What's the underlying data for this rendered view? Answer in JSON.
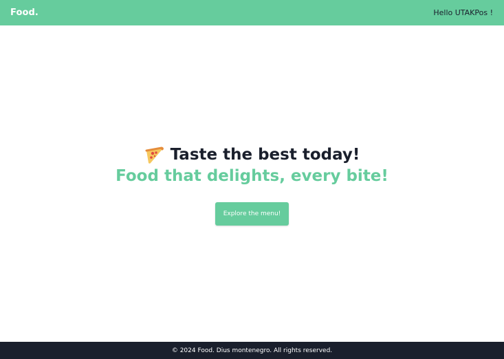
{
  "header": {
    "brand": "Food.",
    "greeting": "Hello UTAKPos !"
  },
  "hero": {
    "icon": "pizza-icon",
    "headline": "Taste the best today!",
    "subtitle": "Food that delights, every bite!",
    "cta_label": "Explore the menu!"
  },
  "footer": {
    "text": "© 2024 Food. Dius montenegro. All rights reserved."
  },
  "colors": {
    "accent": "#66cc9d",
    "dark": "#1a1f2c",
    "background": "#ffffff"
  }
}
